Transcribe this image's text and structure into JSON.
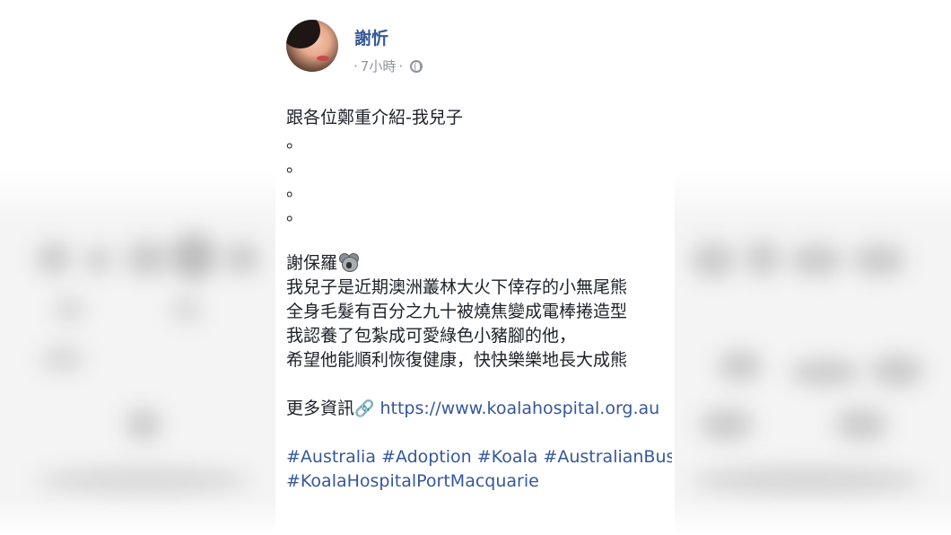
{
  "post": {
    "author": "謝忻",
    "time": "7小時",
    "meta_sep": "·",
    "privacy_icon": "globe-icon",
    "lines": [
      "跟各位鄭重介紹-我兒子",
      "。",
      "。",
      "。",
      "。"
    ],
    "koala_name": "謝保羅",
    "koala_icon": "koala-icon",
    "story": [
      "我兒子是近期澳洲叢林大火下倖存的小無尾熊",
      "全身毛髮有百分之九十被燒焦變成電棒捲造型",
      "我認養了包紮成可愛綠色小豬腳的他，",
      "希望他能順利恢復健康，快快樂樂地長大成熊"
    ],
    "more_info_label": "更多資訊",
    "link_icon": "link-icon",
    "link_text": "https://www.koalahospital.org.au",
    "hashtags_line1": "#Australia #Adoption #Koala #AustralianBush",
    "hashtags_line2": "#KoalaHospitalPortMacquarie"
  },
  "colors": {
    "link": "#365899",
    "text": "#1d2129",
    "meta": "#90949c"
  }
}
